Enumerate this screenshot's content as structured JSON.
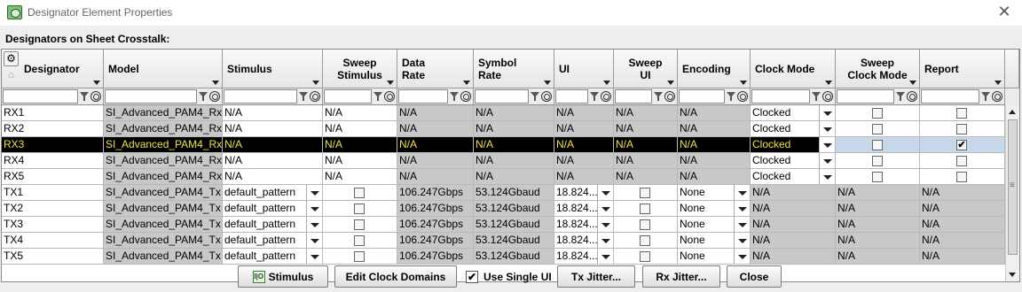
{
  "window": {
    "title": "Designator Element Properties",
    "close_glyph": "✕"
  },
  "section_label": "Designators on Sheet Crosstalk:",
  "columns": [
    {
      "label": "Designator"
    },
    {
      "label": "Model"
    },
    {
      "label": "Stimulus"
    },
    {
      "label": "Sweep\nStimulus"
    },
    {
      "label": "Data\nRate"
    },
    {
      "label": "Symbol\nRate"
    },
    {
      "label": "UI"
    },
    {
      "label": "Sweep\nUI"
    },
    {
      "label": "Encoding"
    },
    {
      "label": "Clock Mode"
    },
    {
      "label": "Sweep\nClock Mode"
    },
    {
      "label": "Report"
    }
  ],
  "rows": [
    {
      "designator": "RX1",
      "model": "SI_Advanced_PAM4_Rx",
      "stimulus": "N/A",
      "sweep_stimulus": "N/A",
      "data_rate": "N/A",
      "symbol_rate": "N/A",
      "ui": "N/A",
      "sweep_ui": "N/A",
      "encoding": "N/A",
      "clock_mode": "Clocked",
      "sweep_clock": false,
      "report": false
    },
    {
      "designator": "RX2",
      "model": "SI_Advanced_PAM4_Rx",
      "stimulus": "N/A",
      "sweep_stimulus": "N/A",
      "data_rate": "N/A",
      "symbol_rate": "N/A",
      "ui": "N/A",
      "sweep_ui": "N/A",
      "encoding": "N/A",
      "clock_mode": "Clocked",
      "sweep_clock": false,
      "report": false
    },
    {
      "designator": "RX3",
      "model": "SI_Advanced_PAM4_Rx",
      "stimulus": "N/A",
      "sweep_stimulus": "N/A",
      "data_rate": "N/A",
      "symbol_rate": "N/A",
      "ui": "N/A",
      "sweep_ui": "N/A",
      "encoding": "N/A",
      "clock_mode": "Clocked",
      "sweep_clock": false,
      "report": true,
      "selected": true
    },
    {
      "designator": "RX4",
      "model": "SI_Advanced_PAM4_Rx",
      "stimulus": "N/A",
      "sweep_stimulus": "N/A",
      "data_rate": "N/A",
      "symbol_rate": "N/A",
      "ui": "N/A",
      "sweep_ui": "N/A",
      "encoding": "N/A",
      "clock_mode": "Clocked",
      "sweep_clock": false,
      "report": false
    },
    {
      "designator": "RX5",
      "model": "SI_Advanced_PAM4_Rx",
      "stimulus": "N/A",
      "sweep_stimulus": "N/A",
      "data_rate": "N/A",
      "symbol_rate": "N/A",
      "ui": "N/A",
      "sweep_ui": "N/A",
      "encoding": "N/A",
      "clock_mode": "Clocked",
      "sweep_clock": false,
      "report": false
    },
    {
      "designator": "TX1",
      "model": "SI_Advanced_PAM4_Tx",
      "stimulus": "default_pattern",
      "sweep_stimulus": false,
      "data_rate": "106.247Gbps",
      "symbol_rate": "53.124Gbaud",
      "ui": "18.824...",
      "sweep_ui": false,
      "encoding": "None",
      "clock_mode": "N/A",
      "sweep_clock": "N/A",
      "report": "N/A"
    },
    {
      "designator": "TX2",
      "model": "SI_Advanced_PAM4_Tx",
      "stimulus": "default_pattern",
      "sweep_stimulus": false,
      "data_rate": "106.247Gbps",
      "symbol_rate": "53.124Gbaud",
      "ui": "18.824...",
      "sweep_ui": false,
      "encoding": "None",
      "clock_mode": "N/A",
      "sweep_clock": "N/A",
      "report": "N/A"
    },
    {
      "designator": "TX3",
      "model": "SI_Advanced_PAM4_Tx",
      "stimulus": "default_pattern",
      "sweep_stimulus": false,
      "data_rate": "106.247Gbps",
      "symbol_rate": "53.124Gbaud",
      "ui": "18.824...",
      "sweep_ui": false,
      "encoding": "None",
      "clock_mode": "N/A",
      "sweep_clock": "N/A",
      "report": "N/A"
    },
    {
      "designator": "TX4",
      "model": "SI_Advanced_PAM4_Tx",
      "stimulus": "default_pattern",
      "sweep_stimulus": false,
      "data_rate": "106.247Gbps",
      "symbol_rate": "53.124Gbaud",
      "ui": "18.824...",
      "sweep_ui": false,
      "encoding": "None",
      "clock_mode": "N/A",
      "sweep_clock": "N/A",
      "report": "N/A"
    },
    {
      "designator": "TX5",
      "model": "SI_Advanced_PAM4_Tx",
      "stimulus": "default_pattern",
      "sweep_stimulus": false,
      "data_rate": "106.247Gbps",
      "symbol_rate": "53.124Gbaud",
      "ui": "18.824...",
      "sweep_ui": false,
      "encoding": "None",
      "clock_mode": "N/A",
      "sweep_clock": "N/A",
      "report": "N/A"
    }
  ],
  "buttons": {
    "stimulus": "Stimulus",
    "stimulus_icon_text": "I|O",
    "edit_clock_domains": "Edit Clock Domains",
    "use_single_ui": "Use Single UI",
    "use_single_ui_checked": true,
    "tx_jitter": "Tx Jitter...",
    "rx_jitter": "Rx Jitter...",
    "close": "Close"
  },
  "colors": {
    "selected_row_bg": "#000000",
    "selected_row_text": "#f0e040",
    "readonly_cell_bg": "#c8c8c8"
  }
}
